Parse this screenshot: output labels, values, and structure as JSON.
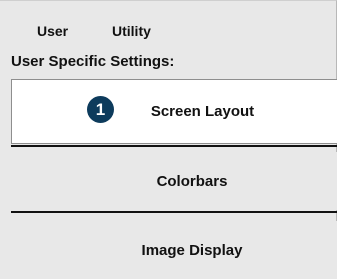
{
  "menubar": {
    "user_label": "User",
    "utility_label": "Utility"
  },
  "section": {
    "label": "User Specific Settings:"
  },
  "buttons": {
    "screen_layout": {
      "label": "Screen Layout",
      "badge": "1",
      "selected": true
    },
    "colorbars": {
      "label": "Colorbars"
    },
    "image_display": {
      "label": "Image Display"
    }
  },
  "colors": {
    "badge_background": "#0d3b5c",
    "selected_background": "#ffffff",
    "panel_background": "#e8e8e8"
  }
}
